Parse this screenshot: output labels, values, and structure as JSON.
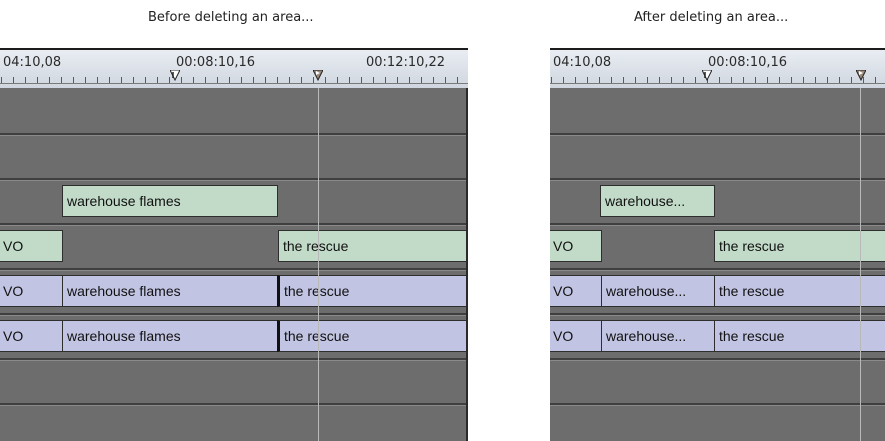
{
  "captions": {
    "before": "Before deleting an area...",
    "after": "After deleting an area..."
  },
  "before": {
    "ruler": {
      "tc1": "04:10,08",
      "tc2": "00:08:10,16",
      "tc3": "00:12:10,22"
    },
    "clips": {
      "v_warehouse": "warehouse flames",
      "a1_vo": "VO",
      "a1_rescue": "the rescue",
      "a2_vo": "VO",
      "a2_warehouse": "warehouse flames",
      "a2_rescue": "the rescue",
      "a3_vo": "VO",
      "a3_warehouse": "warehouse flames",
      "a3_rescue": "the rescue"
    }
  },
  "after": {
    "ruler": {
      "tc1": "04:10,08",
      "tc2": "00:08:10,16"
    },
    "clips": {
      "v_warehouse": "warehouse...",
      "a1_vo": "VO",
      "a1_rescue": "the rescue",
      "a2_vo": "VO",
      "a2_warehouse": "warehouse...",
      "a2_rescue": "the rescue",
      "a3_vo": "VO",
      "a3_warehouse": "warehouse...",
      "a3_rescue": "the rescue"
    }
  },
  "colors": {
    "track_bg": "#6d6d6d",
    "video_clip": "#c2dbc8",
    "audio_clip": "#c2c4e3",
    "ruler_bg": "#dfe4ea"
  }
}
